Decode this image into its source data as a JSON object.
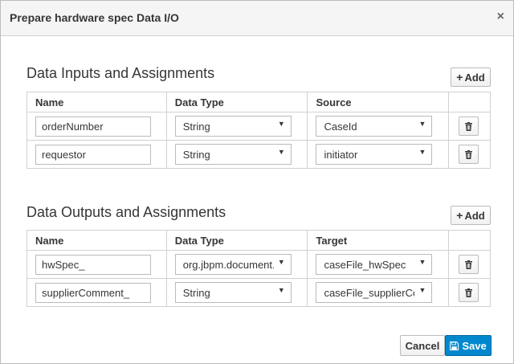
{
  "dialog": {
    "title": "Prepare hardware spec Data I/O",
    "close_glyph": "×"
  },
  "inputs": {
    "title": "Data Inputs and Assignments",
    "add_label": "Add",
    "headers": [
      "Name",
      "Data Type",
      "Source"
    ],
    "rows": [
      {
        "name": "orderNumber",
        "data_type": "String",
        "source": "CaseId"
      },
      {
        "name": "requestor",
        "data_type": "String",
        "source": "initiator"
      }
    ]
  },
  "outputs": {
    "title": "Data Outputs and Assignments",
    "add_label": "Add",
    "headers": [
      "Name",
      "Data Type",
      "Target"
    ],
    "rows": [
      {
        "name": "hwSpec_",
        "data_type": "org.jbpm.document.Document",
        "target": "caseFile_hwSpec"
      },
      {
        "name": "supplierComment_",
        "data_type": "String",
        "target": "caseFile_supplierComment"
      }
    ]
  },
  "footer": {
    "cancel_label": "Cancel",
    "save_label": "Save"
  },
  "colors": {
    "primary": "#0088ce",
    "header_bg": "#f5f5f5",
    "border": "#d1d1d1"
  },
  "icons": {
    "add": "plus-icon",
    "delete": "trash-icon",
    "save": "floppy-disk-icon",
    "dropdown": "caret-down-icon"
  }
}
